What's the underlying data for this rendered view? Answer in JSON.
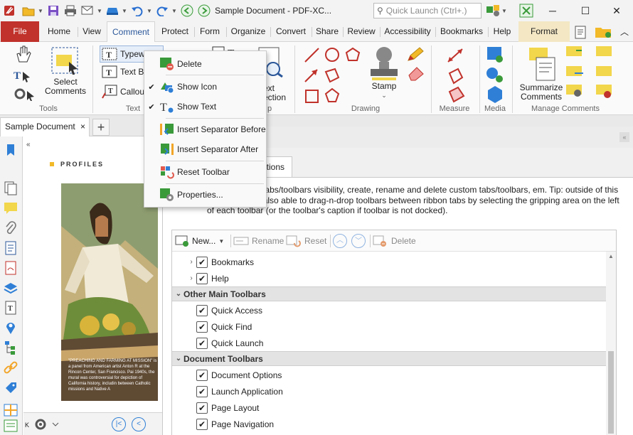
{
  "window": {
    "title": "Sample Document - PDF-XC...",
    "quick_launch_placeholder": "Quick Launch (Ctrl+.)"
  },
  "ribbon_tabs": [
    "File",
    "Home",
    "View",
    "Comment",
    "Protect",
    "Form",
    "Organize",
    "Convert",
    "Share",
    "Review",
    "Accessibility",
    "Bookmarks",
    "Help",
    "Format"
  ],
  "active_tab": "Comment",
  "ribbon": {
    "select_comments": "Select Comments",
    "typewriter": "Typew",
    "text_box": "Text B",
    "callout": "Callou",
    "stamp": "Stamp",
    "summarize": "Summarize Comments",
    "ext_label_1": "ext",
    "ext_label_2": "ection",
    "groups": {
      "tools": "Tools",
      "text": "Text",
      "p": "p",
      "drawing": "Drawing",
      "measure": "Measure",
      "media": "Media",
      "manage": "Manage Comments"
    }
  },
  "document_tab": {
    "label": "Sample Document",
    "close": "×",
    "new": "+"
  },
  "page": {
    "heading": "PROFILES",
    "caption": "\"PREACHING AND FARMING AT MISSION\" is a panel from American artist Anton R at the Rincon Center, San Francisco. Pai 1940s, the mural was controversial for depiction of California history, includin between Catholic missions and Native A"
  },
  "context_menu": {
    "items": [
      {
        "label": "Delete",
        "checked": false
      },
      {
        "label": "Show Icon",
        "checked": true
      },
      {
        "label": "Show Text",
        "checked": true
      },
      {
        "label": "Insert Separator Before",
        "checked": false
      },
      {
        "label": "Insert Separator After",
        "checked": false
      },
      {
        "label": "Reset Toolbar",
        "checked": false
      },
      {
        "label": "Properties...",
        "checked": false
      }
    ]
  },
  "dialog": {
    "options_tab": "ptions",
    "description": "anage Ribbon tabs/toolbars visibility, create, rename and delete custom tabs/toolbars, em. Tip: outside of this dialog you are also able to drag-n-drop toolbars between ribbon tabs by selecting the gripping area on the left of each toolbar (or the toolbar's caption if toolbar is not docked).",
    "toolbar": {
      "new": "New...",
      "rename": "Rename",
      "reset": "Reset",
      "delete": "Delete"
    },
    "tree": [
      {
        "type": "item",
        "label": "Bookmarks",
        "checked": true,
        "expandable": true
      },
      {
        "type": "item",
        "label": "Help",
        "checked": true,
        "expandable": true
      },
      {
        "type": "header",
        "label": "Other Main Toolbars"
      },
      {
        "type": "item",
        "label": "Quick Access",
        "checked": true,
        "expandable": false
      },
      {
        "type": "item",
        "label": "Quick Find",
        "checked": true,
        "expandable": false
      },
      {
        "type": "item",
        "label": "Quick Launch",
        "checked": true,
        "expandable": false
      },
      {
        "type": "header",
        "label": "Document Toolbars"
      },
      {
        "type": "item",
        "label": "Document Options",
        "checked": true,
        "expandable": false
      },
      {
        "type": "item",
        "label": "Launch Application",
        "checked": true,
        "expandable": false
      },
      {
        "type": "item",
        "label": "Page Layout",
        "checked": true,
        "expandable": false
      },
      {
        "type": "item",
        "label": "Page Navigation",
        "checked": true,
        "expandable": false
      }
    ]
  },
  "colors": {
    "file_tab": "#c0322b",
    "accent": "#2b579a",
    "format_tab": "#f3e7c4"
  }
}
